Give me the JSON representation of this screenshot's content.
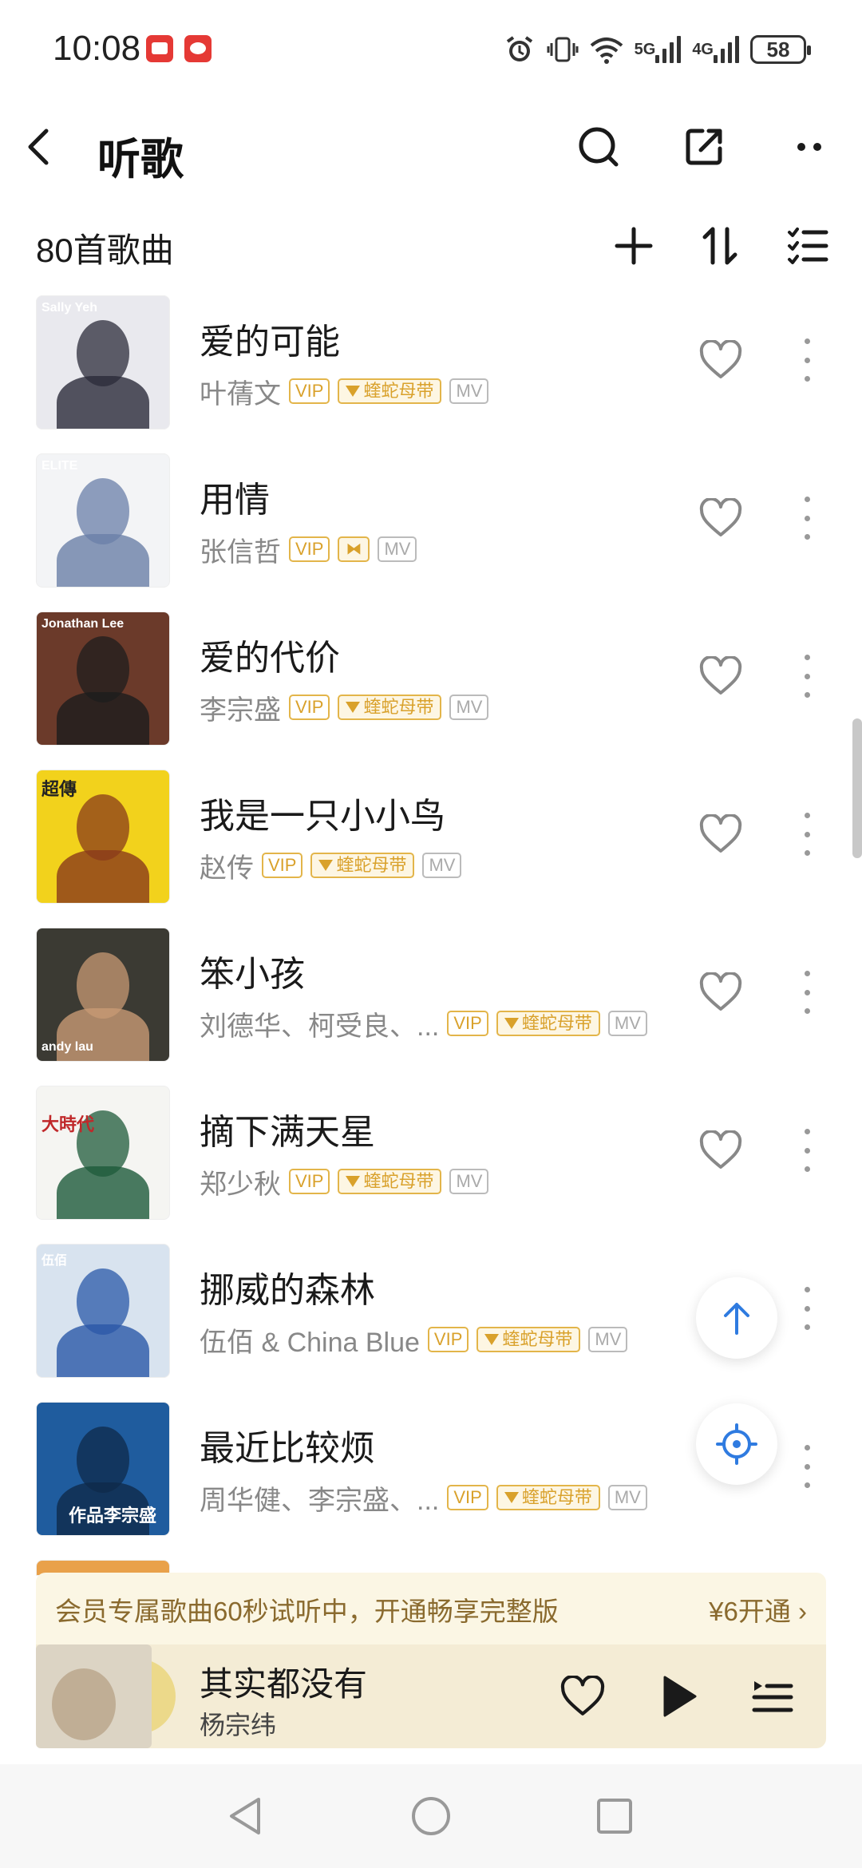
{
  "status_bar": {
    "time": "10:08",
    "net1": "5G",
    "net2": "4G",
    "battery": "58"
  },
  "header": {
    "title": "听歌"
  },
  "list_header": {
    "count_label": "80首歌曲"
  },
  "songs": [
    {
      "title": "爱的可能",
      "artist": "叶蒨文",
      "vip": "VIP",
      "snake": "蝰蛇母带",
      "bow": "",
      "mv": "MV",
      "cover_bg": "#e9e9ee",
      "cover_accent": "#2b2b3a",
      "cover_text": "Sally Yeh"
    },
    {
      "title": "用情",
      "artist": "张信哲",
      "vip": "VIP",
      "snake": "",
      "bow": "⧓",
      "mv": "MV",
      "cover_bg": "#f3f4f6",
      "cover_accent": "#6a7fa8",
      "cover_text": "ELITE"
    },
    {
      "title": "爱的代价",
      "artist": "李宗盛",
      "vip": "VIP",
      "snake": "蝰蛇母带",
      "bow": "",
      "mv": "MV",
      "cover_bg": "#6b3a2a",
      "cover_accent": "#1d1d1d",
      "cover_text": "Jonathan Lee"
    },
    {
      "title": "我是一只小小鸟",
      "artist": "赵传",
      "vip": "VIP",
      "snake": "蝰蛇母带",
      "bow": "",
      "mv": "MV",
      "cover_bg": "#f2d21c",
      "cover_accent": "#8a3b1a",
      "cover_text": "超傳"
    },
    {
      "title": "笨小孩",
      "artist": "刘德华、柯受良、...",
      "vip": "VIP",
      "snake": "蝰蛇母带",
      "bow": "",
      "mv": "MV",
      "cover_bg": "#3b3a33",
      "cover_accent": "#c89a74",
      "cover_text": "andy lau"
    },
    {
      "title": "摘下满天星",
      "artist": "郑少秋",
      "vip": "VIP",
      "snake": "蝰蛇母带",
      "bow": "",
      "mv": "MV",
      "cover_bg": "#f5f5f2",
      "cover_accent": "#1d5a3a",
      "cover_text": "大時代"
    },
    {
      "title": "挪威的森林",
      "artist": "伍佰 & China Blue",
      "vip": "VIP",
      "snake": "蝰蛇母带",
      "bow": "",
      "mv": "MV",
      "cover_bg": "#d8e3ef",
      "cover_accent": "#2a58a8",
      "cover_text": "伍佰"
    },
    {
      "title": "最近比较烦",
      "artist": "周华健、李宗盛、...",
      "vip": "VIP",
      "snake": "蝰蛇母带",
      "bow": "",
      "mv": "MV",
      "cover_bg": "#1f5c9e",
      "cover_accent": "#0f2a4a",
      "cover_text": "作品李宗盛"
    }
  ],
  "vip_banner": {
    "text": "会员专属歌曲60秒试听中，开通畅享完整版",
    "action": "¥6开通 ›"
  },
  "player": {
    "title": "其实都没有",
    "artist": "杨宗纬"
  },
  "colors": {
    "vip_gold": "#d9a12b",
    "fab_blue": "#2f7be0",
    "icon_dark": "#1a1a1a"
  }
}
